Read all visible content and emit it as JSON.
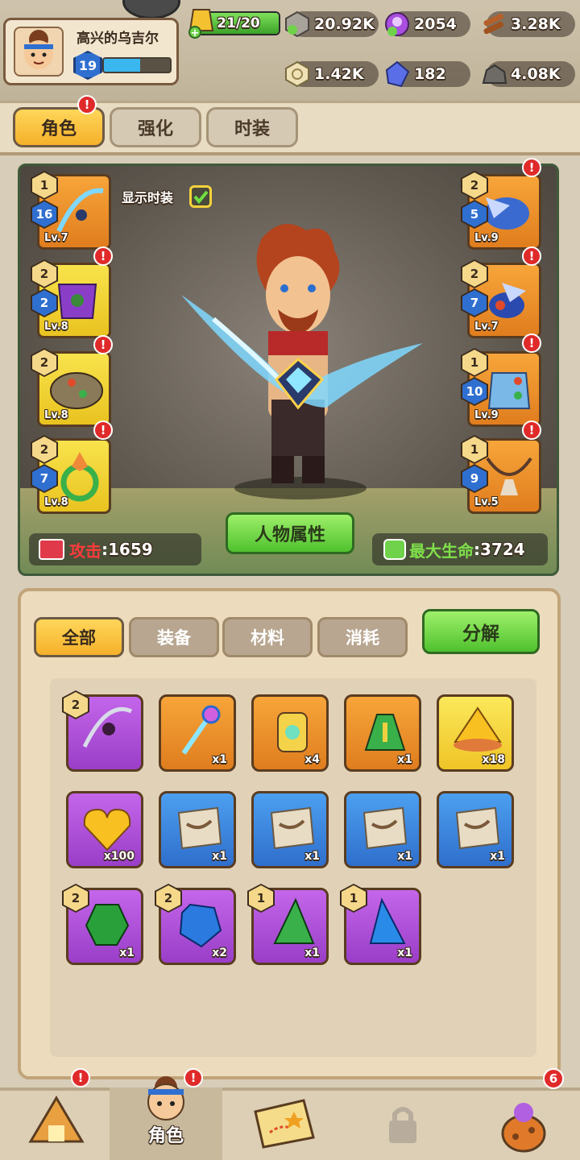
{
  "player": {
    "name": "高兴的乌吉尔",
    "level": "19",
    "xp_fraction": 0.55
  },
  "energy": {
    "text": "21/20",
    "fraction": 1.0
  },
  "resources": {
    "row1": [
      {
        "icon": "silver-coin-icon",
        "value": "20.92K"
      },
      {
        "icon": "purple-gem-icon",
        "value": "2054"
      },
      {
        "icon": "wood-log-icon",
        "value": "3.28K"
      }
    ],
    "row2": [
      {
        "icon": "rune-coin-icon",
        "value": "1.42K"
      },
      {
        "icon": "blue-crystal-icon",
        "value": "182"
      },
      {
        "icon": "stone-ore-icon",
        "value": "4.08K"
      }
    ]
  },
  "tabs": [
    "角色",
    "强化",
    "时装"
  ],
  "show_costume_label": "显示时装",
  "equipment": {
    "left": [
      {
        "tier": "1",
        "rank": "16",
        "level": "Lv.7"
      },
      {
        "tier": "2",
        "rank": "2",
        "level": "Lv.8"
      },
      {
        "tier": "2",
        "level": "Lv.8"
      },
      {
        "tier": "2",
        "rank": "7",
        "level": "Lv.8"
      }
    ],
    "right": [
      {
        "tier": "2",
        "rank": "5",
        "level": "Lv.9"
      },
      {
        "tier": "2",
        "rank": "7",
        "level": "Lv.7"
      },
      {
        "tier": "1",
        "rank": "10",
        "level": "Lv.9"
      },
      {
        "tier": "1",
        "rank": "9",
        "level": "Lv.5"
      }
    ]
  },
  "stats": {
    "attack_label": "攻击",
    "attack_value": "1659",
    "hp_label": "最大生命",
    "hp_value": "3724"
  },
  "char_props_button": "人物属性",
  "inventory_tabs": [
    "全部",
    "装备",
    "材料",
    "消耗"
  ],
  "decompose_button": "分解",
  "items": [
    {
      "color": "p",
      "icon": "bow-icon",
      "tier": "2",
      "count": ""
    },
    {
      "color": "o",
      "icon": "staff-icon",
      "count": "x1"
    },
    {
      "color": "o",
      "icon": "potion-bottle-icon",
      "count": "x4"
    },
    {
      "color": "o",
      "icon": "green-potion-icon",
      "count": "x1"
    },
    {
      "color": "y",
      "icon": "gold-pile-icon",
      "count": "x18"
    },
    {
      "color": "p",
      "icon": "gold-heart-icon",
      "count": "x100"
    },
    {
      "color": "b",
      "icon": "scroll-icon",
      "count": "x1"
    },
    {
      "color": "b",
      "icon": "scroll-icon",
      "count": "x1"
    },
    {
      "color": "b",
      "icon": "scroll-icon",
      "count": "x1"
    },
    {
      "color": "b",
      "icon": "scroll-icon",
      "count": "x1"
    },
    {
      "color": "p",
      "icon": "green-gem-icon",
      "tier": "2",
      "count": "x1"
    },
    {
      "color": "p",
      "icon": "blue-gem-icon",
      "tier": "2",
      "count": "x2"
    },
    {
      "color": "p",
      "icon": "green-shard-icon",
      "tier": "1",
      "count": "x1"
    },
    {
      "color": "p",
      "icon": "blue-shard-icon",
      "tier": "1",
      "count": "x1"
    }
  ],
  "bottom_nav": {
    "active_label": "角色",
    "shop_badge": "6"
  }
}
